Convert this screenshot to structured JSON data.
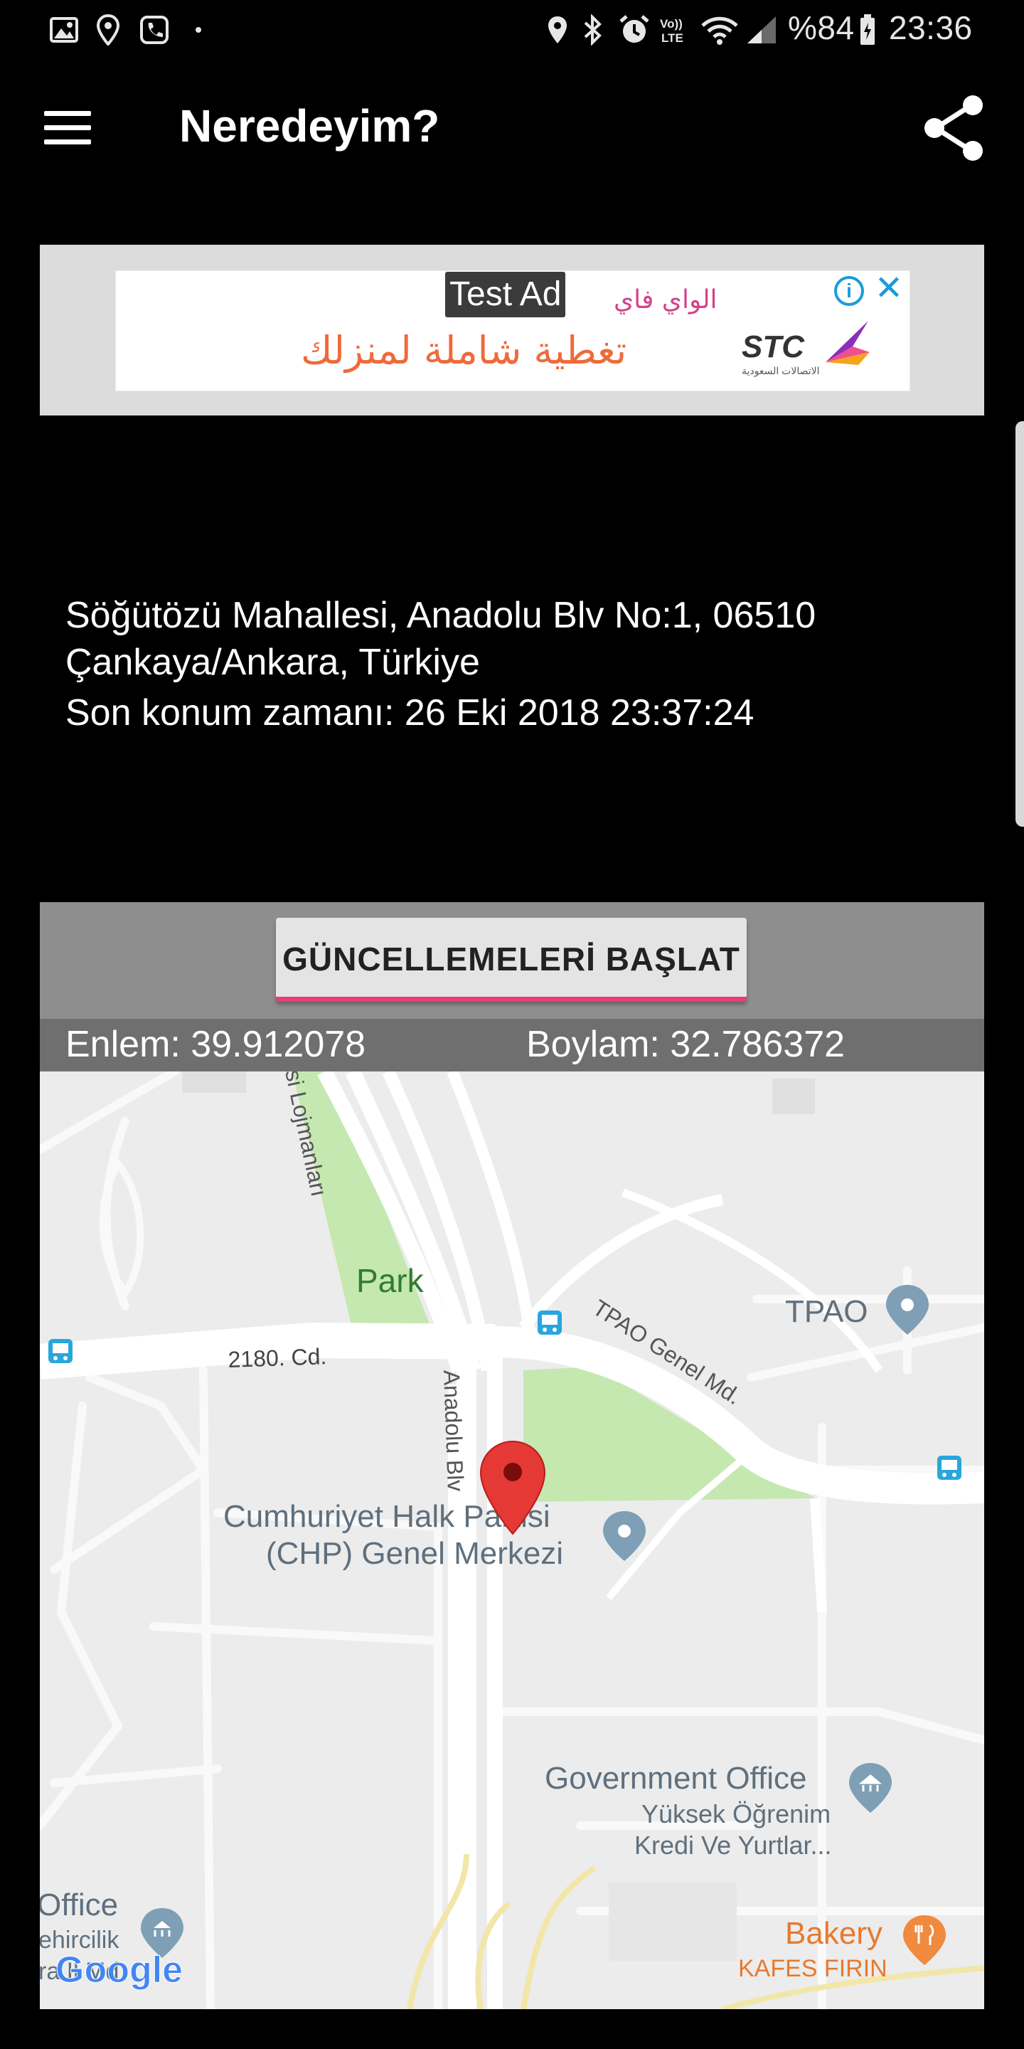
{
  "status_bar": {
    "battery": "%84",
    "time": "23:36",
    "left_icons": [
      "image-icon",
      "location-pin-icon",
      "call-icon",
      "dot-icon"
    ],
    "right_icons": [
      "location-icon",
      "bluetooth-icon",
      "alarm-icon",
      "volte-icon",
      "wifi-icon",
      "signal-icon",
      "battery-icon"
    ]
  },
  "app_bar": {
    "title": "Neredeyim?",
    "menu_icon": "hamburger-menu-icon",
    "share_icon": "share-icon"
  },
  "ad": {
    "label": "Test Ad",
    "arabic_top": "الواي فاي",
    "arabic_main": "تغطية شاملة لمنزلك",
    "brand": "STC",
    "brand_sub": "الاتصالات السعودية",
    "info_icon": "info-icon",
    "close_icon": "close-icon"
  },
  "location": {
    "address": "Söğütözü Mahallesi, Anadolu Blv No:1, 06510 Çankaya/Ankara, Türkiye",
    "last_time": "Son konum zamanı: 26 Eki 2018 23:37:24"
  },
  "controls": {
    "start_button": "GÜNCELLEMELERİ BAŞLAT",
    "latitude": "Enlem: 39.912078",
    "longitude": "Boylam: 32.786372"
  },
  "map": {
    "labels": {
      "park": "Park",
      "street_2180": "2180. Cd.",
      "tpao_road": "TPAO Genel Md.",
      "tpao": "TPAO",
      "anadolu": "Anadolu Blv",
      "lojmanlari": "si Lojmanları",
      "chp_line1": "Cumhuriyet Halk Partisi",
      "chp_line2": "(CHP) Genel Merkezi",
      "gov_office": "Government Office",
      "yuksek1": "Yüksek Öğrenim",
      "yuksek2": "Kredi Ve Yurtlar...",
      "office": "Office",
      "office_sub1": "ehircilik",
      "office_sub2": "ra İl Md",
      "bakery": "Bakery",
      "kafes": "KAFES FIRIN",
      "google": "Google"
    },
    "colors": {
      "background": "#ececec",
      "road": "#ffffff",
      "park": "#c5e8b0",
      "pin": "#e53935",
      "poi": "#7e9fb5",
      "bakery": "#f08a3e"
    }
  }
}
